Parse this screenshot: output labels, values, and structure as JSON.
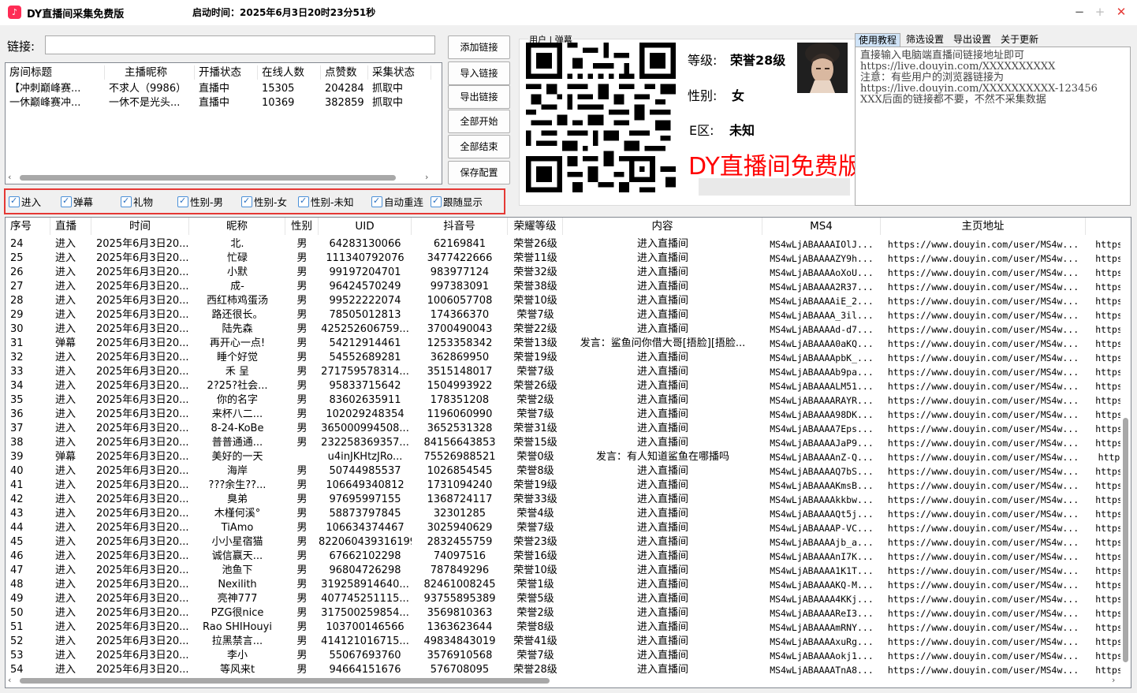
{
  "window": {
    "title": "DY直播间采集免费版",
    "start_time": "启动时间：2025年6月3日20时23分51秒",
    "icon": "douyin-icon",
    "controls": [
      "−",
      "+",
      "✕"
    ]
  },
  "link": {
    "label": "链接:",
    "value": ""
  },
  "room_table": {
    "columns": [
      "房间标题",
      "主播昵称",
      "开播状态",
      "在线人数",
      "点赞数",
      "采集状态"
    ],
    "rows": [
      [
        "【冲刺巅峰赛...",
        "不求人（9986）",
        "直播中",
        "15305",
        "204284",
        "抓取中"
      ],
      [
        "一休巅峰赛冲...",
        "一休不是光头...",
        "直播中",
        "10369",
        "382859",
        "抓取中"
      ]
    ]
  },
  "buttons": [
    "添加链接",
    "导入链接",
    "导出链接",
    "全部开始",
    "全部结束",
    "保存配置"
  ],
  "filters": [
    {
      "label": "进入",
      "checked": true
    },
    {
      "label": "弹幕",
      "checked": true
    },
    {
      "label": "礼物",
      "checked": true
    },
    {
      "label": "性别-男",
      "checked": true
    },
    {
      "label": "性别-女",
      "checked": true
    },
    {
      "label": "性别-未知",
      "checked": true
    },
    {
      "label": "自动重连",
      "checked": true
    },
    {
      "label": "跟随显示",
      "checked": true
    }
  ],
  "user_panel": {
    "legend": "用户 | 弹幕",
    "level_label": "等级:",
    "level_value": "荣誉28级",
    "gender_label": "性别:",
    "gender_value": "女",
    "region_label": "E区:",
    "region_value": "未知",
    "promo": "DY直播间免费版本!"
  },
  "tabs": [
    "使用教程",
    "筛选设置",
    "导出设置",
    "关于更新"
  ],
  "tutorial_text": "直接输入电脑端直播间链接地址即可\nhttps://live.douyin.com/XXXXXXXXXX\n注意：有些用户的浏览器链接为\nhttps://live.douyin.com/XXXXXXXXXX-123456\nXXX后面的链接都不要，不然不采集数据",
  "main_table": {
    "columns": [
      "序号",
      "直播",
      "时间",
      "昵称",
      "性别",
      "UID",
      "抖音号",
      "荣耀等级",
      "内容",
      "MS4",
      "主页地址",
      ""
    ],
    "rows": [
      [
        "24",
        "进入",
        "2025年6月3日20...",
        "北.",
        "男",
        "64283130066",
        "62169841",
        "荣誉26级",
        "进入直播间",
        "MS4wLjABAAAAIOlJ...",
        "https://www.douyin.com/user/MS4w...",
        "https"
      ],
      [
        "25",
        "进入",
        "2025年6月3日20...",
        "忙碌",
        "男",
        "111340792076",
        "3477422666",
        "荣誉11级",
        "进入直播间",
        "MS4wLjABAAAAZY9h...",
        "https://www.douyin.com/user/MS4w...",
        "https"
      ],
      [
        "26",
        "进入",
        "2025年6月3日20...",
        "小默",
        "男",
        "99197204701",
        "983977124",
        "荣誉32级",
        "进入直播间",
        "MS4wLjABAAAAoXoU...",
        "https://www.douyin.com/user/MS4w...",
        "https"
      ],
      [
        "27",
        "进入",
        "2025年6月3日20...",
        "成-",
        "男",
        "96424570249",
        "997383091",
        "荣誉38级",
        "进入直播间",
        "MS4wLjABAAAA2R37...",
        "https://www.douyin.com/user/MS4w...",
        "https"
      ],
      [
        "28",
        "进入",
        "2025年6月3日20...",
        "西红柿鸡蛋汤",
        "男",
        "99522222074",
        "1006057708",
        "荣誉10级",
        "进入直播间",
        "MS4wLjABAAAAiE_2...",
        "https://www.douyin.com/user/MS4w...",
        "https"
      ],
      [
        "29",
        "进入",
        "2025年6月3日20...",
        "路还很长。",
        "男",
        "78505012813",
        "174366370",
        "荣誉7级",
        "进入直播间",
        "MS4wLjABAAAA_3il...",
        "https://www.douyin.com/user/MS4w...",
        "https"
      ],
      [
        "30",
        "进入",
        "2025年6月3日20...",
        "陆先森",
        "男",
        "425252606759...",
        "3700490043",
        "荣誉22级",
        "进入直播间",
        "MS4wLjABAAAAd-d7...",
        "https://www.douyin.com/user/MS4w...",
        "https"
      ],
      [
        "31",
        "弹幕",
        "2025年6月3日20...",
        "再开心一点!",
        "男",
        "54212914461",
        "1253358342",
        "荣誉13级",
        "发言：鲨鱼问你借大哥[捂脸][捂脸...",
        "MS4wLjABAAAA0aKQ...",
        "https://www.douyin.com/user/MS4w...",
        "https"
      ],
      [
        "32",
        "进入",
        "2025年6月3日20...",
        "睡个好觉",
        "男",
        "54552689281",
        "362869950",
        "荣誉19级",
        "进入直播间",
        "MS4wLjABAAAApbK_...",
        "https://www.douyin.com/user/MS4w...",
        "https"
      ],
      [
        "33",
        "进入",
        "2025年6月3日20...",
        "禾 呈",
        "男",
        "271759578314...",
        "3515148017",
        "荣誉7级",
        "进入直播间",
        "MS4wLjABAAAAb9pa...",
        "https://www.douyin.com/user/MS4w...",
        "https"
      ],
      [
        "34",
        "进入",
        "2025年6月3日20...",
        "2?25?社会...",
        "男",
        "95833715642",
        "1504993922",
        "荣誉26级",
        "进入直播间",
        "MS4wLjABAAAALM51...",
        "https://www.douyin.com/user/MS4w...",
        "https"
      ],
      [
        "35",
        "进入",
        "2025年6月3日20...",
        "你的名字",
        "男",
        "83602635911",
        "178351208",
        "荣誉2级",
        "进入直播间",
        "MS4wLjABAAAARAYR...",
        "https://www.douyin.com/user/MS4w...",
        "https"
      ],
      [
        "36",
        "进入",
        "2025年6月3日20...",
        "来杯八二...",
        "男",
        "102029248354",
        "1196060990",
        "荣誉7级",
        "进入直播间",
        "MS4wLjABAAAA98DK...",
        "https://www.douyin.com/user/MS4w...",
        "https"
      ],
      [
        "37",
        "进入",
        "2025年6月3日20...",
        "8-24-KoBe",
        "男",
        "365000994508...",
        "3652531328",
        "荣誉31级",
        "进入直播间",
        "MS4wLjABAAAA7Eps...",
        "https://www.douyin.com/user/MS4w...",
        "https"
      ],
      [
        "38",
        "进入",
        "2025年6月3日20...",
        "普普通通...",
        "男",
        "232258369357...",
        "84156643853",
        "荣誉15级",
        "进入直播间",
        "MS4wLjABAAAAJaP9...",
        "https://www.douyin.com/user/MS4w...",
        "https"
      ],
      [
        "39",
        "弹幕",
        "2025年6月3日20...",
        "美好的一天",
        "",
        "u4inJKHtzJRo...",
        "75526988521",
        "荣誉0级",
        "发言：有人知道鲨鱼在哪播吗",
        "MS4wLjABAAAAnZ-Q...",
        "https://www.douyin.com/user/MS4w...",
        "http"
      ],
      [
        "40",
        "进入",
        "2025年6月3日20...",
        "海岸",
        "男",
        "50744985537",
        "1026854545",
        "荣誉8级",
        "进入直播间",
        "MS4wLjABAAAAQ7bS...",
        "https://www.douyin.com/user/MS4w...",
        "https"
      ],
      [
        "41",
        "进入",
        "2025年6月3日20...",
        "???余生??...",
        "男",
        "106649340812",
        "1731094240",
        "荣誉19级",
        "进入直播间",
        "MS4wLjABAAAAKmsB...",
        "https://www.douyin.com/user/MS4w...",
        "https"
      ],
      [
        "42",
        "进入",
        "2025年6月3日20...",
        "臭弟",
        "男",
        "97695997155",
        "1368724117",
        "荣誉33级",
        "进入直播间",
        "MS4wLjABAAAAkkbw...",
        "https://www.douyin.com/user/MS4w...",
        "https"
      ],
      [
        "43",
        "进入",
        "2025年6月3日20...",
        "木槿何溪°",
        "男",
        "58873797845",
        "32301285",
        "荣誉4级",
        "进入直播间",
        "MS4wLjABAAAAQt5j...",
        "https://www.douyin.com/user/MS4w...",
        "https"
      ],
      [
        "44",
        "进入",
        "2025年6月3日20...",
        "TiAmo",
        "男",
        "106634374467",
        "3025940629",
        "荣誉7级",
        "进入直播间",
        "MS4wLjABAAAAP-VC...",
        "https://www.douyin.com/user/MS4w...",
        "https"
      ],
      [
        "45",
        "进入",
        "2025年6月3日20...",
        "小小星宿猫",
        "男",
        "822060439316199",
        "2832455759",
        "荣誉23级",
        "进入直播间",
        "MS4wLjABAAAAjb_a...",
        "https://www.douyin.com/user/MS4w...",
        "https"
      ],
      [
        "46",
        "进入",
        "2025年6月3日20...",
        "诚信赢天...",
        "男",
        "67662102298",
        "74097516",
        "荣誉16级",
        "进入直播间",
        "MS4wLjABAAAAnI7K...",
        "https://www.douyin.com/user/MS4w...",
        "https"
      ],
      [
        "47",
        "进入",
        "2025年6月3日20...",
        "池鱼下",
        "男",
        "96804726298",
        "787849296",
        "荣誉10级",
        "进入直播间",
        "MS4wLjABAAAA1K1T...",
        "https://www.douyin.com/user/MS4w...",
        "https"
      ],
      [
        "48",
        "进入",
        "2025年6月3日20...",
        "Nexilith",
        "男",
        "319258914640...",
        "82461008245",
        "荣誉1级",
        "进入直播间",
        "MS4wLjABAAAAKQ-M...",
        "https://www.douyin.com/user/MS4w...",
        "https"
      ],
      [
        "49",
        "进入",
        "2025年6月3日20...",
        "亮神777",
        "男",
        "407745251115...",
        "93755895389",
        "荣誉5级",
        "进入直播间",
        "MS4wLjABAAAA4KKj...",
        "https://www.douyin.com/user/MS4w...",
        "https"
      ],
      [
        "50",
        "进入",
        "2025年6月3日20...",
        "PZG很nice",
        "男",
        "317500259854...",
        "3569810363",
        "荣誉2级",
        "进入直播间",
        "MS4wLjABAAAAReI3...",
        "https://www.douyin.com/user/MS4w...",
        "https"
      ],
      [
        "51",
        "进入",
        "2025年6月3日20...",
        "Rao SHIHouyi",
        "男",
        "103700146566",
        "1363623644",
        "荣誉8级",
        "进入直播间",
        "MS4wLjABAAAAmRNY...",
        "https://www.douyin.com/user/MS4w...",
        "https"
      ],
      [
        "52",
        "进入",
        "2025年6月3日20...",
        "拉黑禁言...",
        "男",
        "414121016715...",
        "49834843019",
        "荣誉41级",
        "进入直播间",
        "MS4wLjABAAAAxuRg...",
        "https://www.douyin.com/user/MS4w...",
        "https"
      ],
      [
        "53",
        "进入",
        "2025年6月3日20...",
        "李小",
        "男",
        "55067693760",
        "3576910568",
        "荣誉7级",
        "进入直播间",
        "MS4wLjABAAAAokj1...",
        "https://www.douyin.com/user/MS4w...",
        "https"
      ],
      [
        "54",
        "进入",
        "2025年6月3日20...",
        "等风来t",
        "男",
        "94664151676",
        "576708095",
        "荣誉28级",
        "进入直播间",
        "MS4wLjABAAAATnA8...",
        "https://www.douyin.com/user/MS4w...",
        "https"
      ]
    ]
  },
  "colors": {
    "accent": "#fe2c55",
    "filter_border": "#e53935",
    "promo": "#ff0000",
    "selected_tab": "#cfe3f7"
  }
}
